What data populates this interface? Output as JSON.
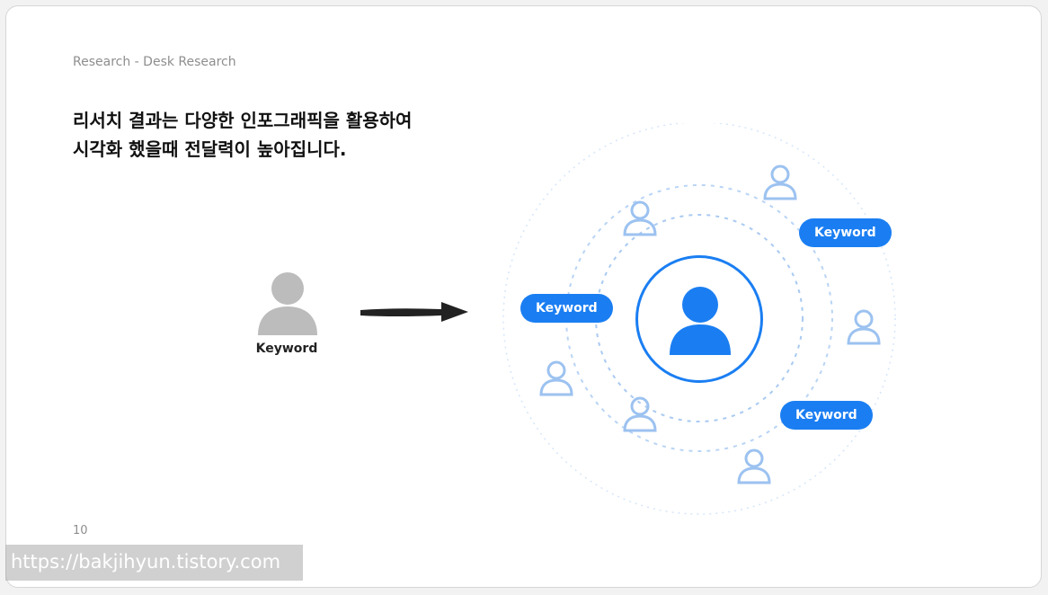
{
  "slide": {
    "breadcrumb": "Research - Desk Research",
    "headline_line1": "리서치 결과는 다양한 인포그래픽을 활용하여",
    "headline_line2": "시각화 했을때 전달력이 높아집니다.",
    "page_number": "10"
  },
  "left": {
    "label": "Keyword",
    "icon": "person-icon",
    "color": "#bcbcbc"
  },
  "arrow": {
    "icon": "arrow-right-icon",
    "color": "#222222"
  },
  "diagram": {
    "accent": "#1a7ef2",
    "ring_color": "#b9d4f5",
    "center_icon": "person-icon",
    "node_icon": "person-outline-icon",
    "pills": [
      "Keyword",
      "Keyword",
      "Keyword"
    ]
  },
  "watermark": {
    "url": "https://bakjihyun.tistory.com"
  }
}
